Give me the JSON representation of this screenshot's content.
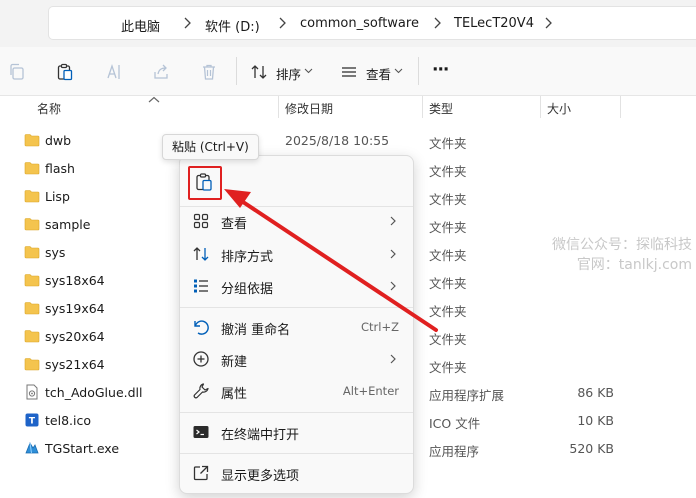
{
  "breadcrumb": [
    "此电脑",
    "软件 (D:)",
    "common_software",
    "TELecT20V4"
  ],
  "toolbar": {
    "sort_label": "排序",
    "view_label": "查看",
    "more_label": "···"
  },
  "columns": {
    "name": "名称",
    "modified": "修改日期",
    "type": "类型",
    "size": "大小"
  },
  "files": [
    {
      "name": "dwb",
      "date": "2025/8/18 10:55",
      "type": "文件夹",
      "size": "",
      "icon": "folder-icon"
    },
    {
      "name": "flash",
      "date": "",
      "type": "文件夹",
      "size": "",
      "icon": "folder-icon"
    },
    {
      "name": "Lisp",
      "date": "",
      "type": "文件夹",
      "size": "",
      "icon": "folder-icon"
    },
    {
      "name": "sample",
      "date": "",
      "type": "文件夹",
      "size": "",
      "icon": "folder-icon"
    },
    {
      "name": "sys",
      "date": "",
      "type": "文件夹",
      "size": "",
      "icon": "folder-icon"
    },
    {
      "name": "sys18x64",
      "date": "",
      "type": "文件夹",
      "size": "",
      "icon": "folder-icon"
    },
    {
      "name": "sys19x64",
      "date": "",
      "type": "文件夹",
      "size": "",
      "icon": "folder-icon"
    },
    {
      "name": "sys20x64",
      "date": "",
      "type": "文件夹",
      "size": "",
      "icon": "folder-icon"
    },
    {
      "name": "sys21x64",
      "date": "",
      "type": "文件夹",
      "size": "",
      "icon": "folder-icon"
    },
    {
      "name": "tch_AdoGlue.dll",
      "date": "",
      "type": "应用程序扩展",
      "size": "86 KB",
      "icon": "dll-file-icon"
    },
    {
      "name": "tel8.ico",
      "date": "",
      "type": "ICO 文件",
      "size": "10 KB",
      "icon": "ico-file-icon"
    },
    {
      "name": "TGStart.exe",
      "date": "",
      "type": "应用程序",
      "size": "520 KB",
      "icon": "exe-file-icon"
    }
  ],
  "context_menu": {
    "paste_tooltip": "粘贴 (Ctrl+V)",
    "items": [
      {
        "label": "查看",
        "icon": "grid-view-icon",
        "submenu": true,
        "shortcut": ""
      },
      {
        "label": "排序方式",
        "icon": "sort-icon",
        "submenu": true,
        "shortcut": ""
      },
      {
        "label": "分组依据",
        "icon": "group-by-icon",
        "submenu": true,
        "shortcut": ""
      },
      {
        "label": "撤消 重命名",
        "icon": "undo-icon",
        "submenu": false,
        "shortcut": "Ctrl+Z"
      },
      {
        "label": "新建",
        "icon": "new-plus-icon",
        "submenu": true,
        "shortcut": ""
      },
      {
        "label": "属性",
        "icon": "wrench-icon",
        "submenu": false,
        "shortcut": "Alt+Enter"
      },
      {
        "label": "在终端中打开",
        "icon": "terminal-icon",
        "submenu": false,
        "shortcut": ""
      },
      {
        "label": "显示更多选项",
        "icon": "show-more-icon",
        "submenu": false,
        "shortcut": ""
      }
    ]
  },
  "watermark": {
    "line1": "微信公众号：探临科技",
    "line2": "官网：tanlkj.com"
  },
  "colors": {
    "folder": "#f4c44e",
    "accent": "#005fb8",
    "highlight": "#e02020"
  }
}
